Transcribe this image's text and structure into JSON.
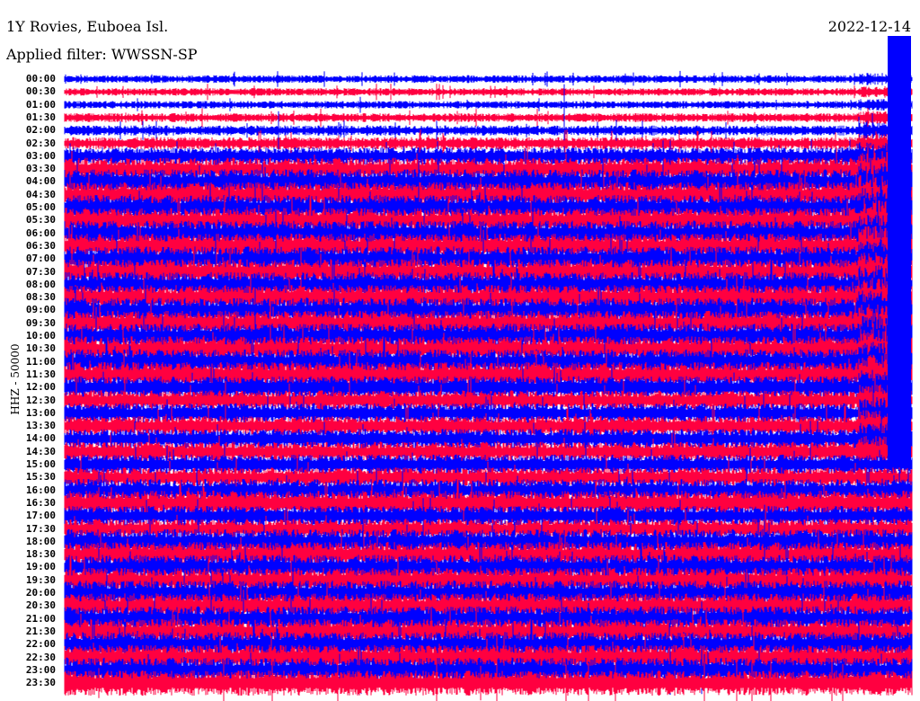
{
  "header": {
    "station": "1Y Rovies, Euboea Isl.",
    "filter": "Applied filter: WWSSN-SP",
    "date": "2022-12-14"
  },
  "chart_data": {
    "type": "line",
    "title": "1Y Rovies, Euboea Isl.",
    "ylabel": "HHZ - 50000",
    "xlabel": "",
    "colors": [
      "#0000ff",
      "#ff0040"
    ],
    "row_labels": [
      "00:00",
      "00:30",
      "01:00",
      "01:30",
      "02:00",
      "02:30",
      "03:00",
      "03:30",
      "04:00",
      "04:30",
      "05:00",
      "05:30",
      "06:00",
      "06:30",
      "07:00",
      "07:30",
      "08:00",
      "08:30",
      "09:00",
      "09:30",
      "10:00",
      "10:30",
      "11:00",
      "11:30",
      "12:00",
      "12:30",
      "13:00",
      "13:30",
      "14:00",
      "14:30",
      "15:00",
      "15:30",
      "16:00",
      "16:30",
      "17:00",
      "17:30",
      "18:00",
      "18:30",
      "19:00",
      "19:30",
      "20:00",
      "20:30",
      "21:00",
      "21:30",
      "22:00",
      "22:30",
      "23:00",
      "23:30"
    ],
    "relative_amplitude": [
      0.3,
      0.3,
      0.3,
      0.35,
      0.4,
      0.5,
      0.7,
      0.9,
      1,
      1,
      1,
      1,
      1,
      1,
      1,
      1,
      1,
      1,
      1,
      1,
      1,
      1,
      1,
      1,
      0.9,
      0.8,
      0.8,
      0.8,
      0.8,
      0.8,
      0.8,
      0.8,
      0.9,
      1,
      0.8,
      0.8,
      1,
      1,
      1,
      1,
      1,
      1,
      1,
      1,
      1,
      1,
      1,
      1
    ],
    "minutes_per_row": 30
  }
}
